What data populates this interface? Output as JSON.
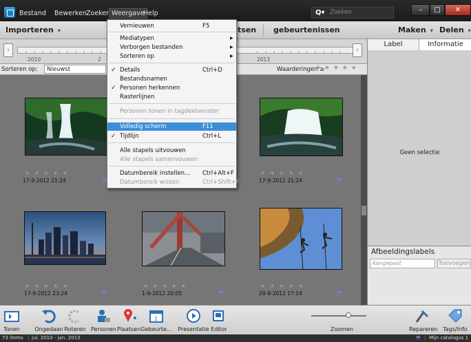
{
  "menubar": {
    "items": [
      "Bestand",
      "Bewerken",
      "Zoeken",
      "Weergave",
      "Help"
    ],
    "search_placeholder": "Zoeken",
    "window_min": "–",
    "window_max": "□",
    "window_close": "✕"
  },
  "toolbar": {
    "import_label": "Importeren",
    "tab_partial": "tsen",
    "tab_events": "gebeurtenissen",
    "make_label": "Maken",
    "share_label": "Delen"
  },
  "timeline": {
    "year_left": "2010",
    "year_mid_partial": "2",
    "year_right": "2013"
  },
  "sortbar": {
    "label": "Sorteren op:",
    "value": "Nieuwst",
    "ratings_label": "Waarderingen",
    "ratings_op": "≥",
    "stars": "★ ★ ★ ★ ★"
  },
  "photos": [
    {
      "date": "17-9-2012 21:24",
      "stars": "★ ★ ★ ★ ★",
      "kind": "waterfall"
    },
    {
      "date": "17-9-2012 21:24",
      "stars": "★ ★ ★ ★ ★",
      "kind": "waterfall"
    },
    {
      "date": "17-9-2012 23:24",
      "stars": "★ ★ ★ ★ ★",
      "kind": "skyline"
    },
    {
      "date": "1-9-2012 20:05",
      "stars": "★ ★ ★ ★ ★",
      "kind": "bridge"
    },
    {
      "date": "29-8-2012 17:14",
      "stars": "★ ★ ★ ★ ★",
      "kind": "climbers"
    }
  ],
  "right_panel": {
    "tab_label": "Label",
    "tab_info": "Informatie",
    "no_selection": "Geen selectie",
    "image_labels_heading": "Afbeeldingslabels",
    "custom_placeholder": "Aangepast",
    "add_button": "Toevoegen"
  },
  "menu": {
    "items": [
      {
        "label": "Vernieuwen",
        "shortcut": "F5"
      },
      {
        "label": "Mediatypen",
        "submenu": "▶"
      },
      {
        "label": "Verborgen bestanden",
        "submenu": "▶"
      },
      {
        "label": "Sorteren op",
        "submenu": "▶"
      },
      {
        "label": "Details",
        "shortcut": "Ctrl+D",
        "check": "✓"
      },
      {
        "label": "Bestandsnamen"
      },
      {
        "label": "Personen herkennen",
        "check": "✓"
      },
      {
        "label": "Rasterlijnen"
      },
      {
        "label": "Personen tonen in tagdeelvenster",
        "disabled": true
      },
      {
        "label": "Volledig scherm",
        "shortcut": "F11",
        "highlighted": true
      },
      {
        "label": "Tijdlijn",
        "shortcut": "Ctrl+L",
        "check": "✓"
      },
      {
        "label": "Alle stapels uitvouwen"
      },
      {
        "label": "Alle stapels samenvouwen",
        "disabled": true
      },
      {
        "label": "Datumbereik instellen...",
        "shortcut": "Ctrl+Alt+F"
      },
      {
        "label": "Datumbereik wissen",
        "shortcut": "Ctrl+Shift+F",
        "disabled": true
      }
    ]
  },
  "bottom": {
    "tonen": "Tonen",
    "ongedaan": "Ongedaan",
    "roteren": "Roteren",
    "personen": "Personen",
    "plaatsen": "Plaatsen",
    "gebeurte": "Gebeurte...",
    "presentatie": "Presentatie",
    "editor": "Editor",
    "zoomen": "Zoomen",
    "repareren": "Repareren",
    "tagsinfo": "Tags/Info"
  },
  "status": {
    "items": "73 items",
    "range": "jul. 2010 - jan. 2013",
    "catalog": "Mijn catalogus 1"
  },
  "colors": {
    "highlight": "#3b8fd6",
    "accent_red": "#c1272d",
    "pin_red": "#d9383a"
  }
}
